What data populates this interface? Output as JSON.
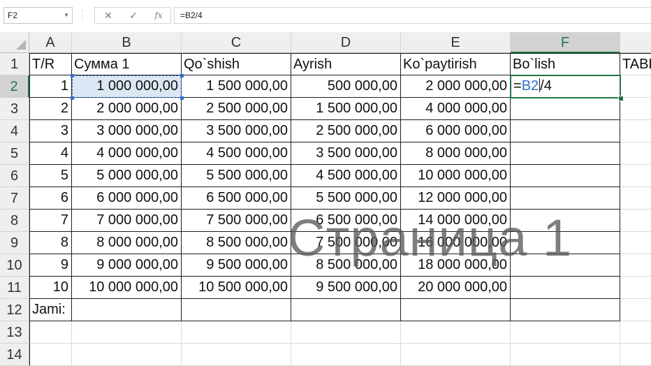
{
  "formula_bar": {
    "name_box": "F2",
    "formula": "=B2/4",
    "cancel_icon": "x-icon",
    "enter_icon": "check-icon",
    "function_icon": "fx-icon",
    "fx_label": "fx",
    "cancel_glyph": "✕",
    "enter_glyph": "✓"
  },
  "columns": [
    "A",
    "B",
    "C",
    "D",
    "E",
    "F"
  ],
  "active_column": "F",
  "active_row": "2",
  "rows": [
    {
      "num": "1",
      "cells": [
        "T/R",
        "Сумма 1",
        "Qo`shish",
        "Ayrish",
        "Ko`paytirish",
        "Bo`lish",
        "TABLE"
      ]
    },
    {
      "num": "2",
      "cells": [
        "1",
        "1 000 000,00",
        "1 500 000,00",
        "500 000,00",
        "2 000 000,00",
        "",
        ""
      ]
    },
    {
      "num": "3",
      "cells": [
        "2",
        "2 000 000,00",
        "2 500 000,00",
        "1 500 000,00",
        "4 000 000,00",
        "",
        ""
      ]
    },
    {
      "num": "4",
      "cells": [
        "3",
        "3 000 000,00",
        "3 500 000,00",
        "2 500 000,00",
        "6 000 000,00",
        "",
        ""
      ]
    },
    {
      "num": "5",
      "cells": [
        "4",
        "4 000 000,00",
        "4 500 000,00",
        "3 500 000,00",
        "8 000 000,00",
        "",
        ""
      ]
    },
    {
      "num": "6",
      "cells": [
        "5",
        "5 000 000,00",
        "5 500 000,00",
        "4 500 000,00",
        "10 000 000,00",
        "",
        ""
      ]
    },
    {
      "num": "7",
      "cells": [
        "6",
        "6 000 000,00",
        "6 500 000,00",
        "5 500 000,00",
        "12 000 000,00",
        "",
        ""
      ]
    },
    {
      "num": "8",
      "cells": [
        "7",
        "7 000 000,00",
        "7 500 000,00",
        "6 500 000,00",
        "14 000 000,00",
        "",
        ""
      ]
    },
    {
      "num": "9",
      "cells": [
        "8",
        "8 000 000,00",
        "8 500 000,00",
        "7 500 000,00",
        "16 000 000,00",
        "",
        ""
      ]
    },
    {
      "num": "10",
      "cells": [
        "9",
        "9 000 000,00",
        "9 500 000,00",
        "8 500 000,00",
        "18 000 000,00",
        "",
        ""
      ]
    },
    {
      "num": "11",
      "cells": [
        "10",
        "10 000 000,00",
        "10 500 000,00",
        "9 500 000,00",
        "20 000 000,00",
        "",
        ""
      ]
    },
    {
      "num": "12",
      "cells": [
        "Jami:",
        "",
        "",
        "",
        "",
        "",
        ""
      ]
    },
    {
      "num": "13",
      "cells": [
        "",
        "",
        "",
        "",
        "",
        "",
        ""
      ]
    },
    {
      "num": "14",
      "cells": [
        "",
        "",
        "",
        "",
        "",
        "",
        ""
      ]
    }
  ],
  "edit_cell": {
    "prefix": "=",
    "ref": "B2",
    "suffix": "/4"
  },
  "watermark": "Страница 1",
  "colors": {
    "accent_green": "#217346",
    "reference_blue": "#2f6fd1"
  }
}
